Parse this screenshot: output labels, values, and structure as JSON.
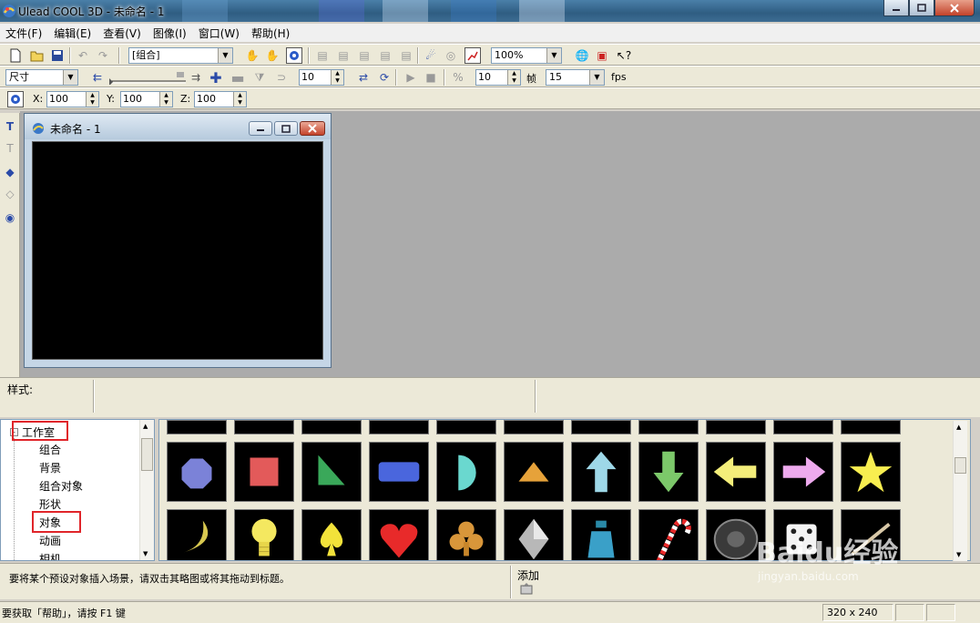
{
  "window": {
    "title": "Ulead COOL 3D - 未命名 - 1"
  },
  "menu": [
    "文件(F)",
    "编辑(E)",
    "查看(V)",
    "图像(I)",
    "窗口(W)",
    "帮助(H)"
  ],
  "toolbar1": {
    "group_select": "[组合]",
    "zoom": "100%"
  },
  "toolbar2": {
    "attribute_select": "尺寸",
    "frame_value": "10",
    "frames_value": "10",
    "frame_label": "帧",
    "fps_value": "15",
    "fps_label": "fps"
  },
  "toolbar3": {
    "x_label": "X:",
    "x_value": "100",
    "y_label": "Y:",
    "y_value": "100",
    "z_label": "Z:",
    "z_value": "100"
  },
  "document": {
    "title": "未命名 - 1"
  },
  "style_bar": {
    "label": "样式:"
  },
  "tree": {
    "root": "工作室",
    "items": [
      "组合",
      "背景",
      "组合对象",
      "形状",
      "对象",
      "动画",
      "相机"
    ],
    "highlighted": [
      "工作室",
      "对象"
    ]
  },
  "thumbnails": {
    "row1": [
      "octagon-icon",
      "square-icon",
      "triangle-icon",
      "rounded-rect-icon",
      "half-circle-icon",
      "flat-triangle-icon",
      "up-arrow-icon",
      "down-arrow-icon",
      "left-arrow-icon",
      "right-arrow-icon",
      "star-icon"
    ],
    "row2": [
      "crescent-moon-icon",
      "light-bulb-icon",
      "spade-icon",
      "heart-icon",
      "club-icon",
      "diamond-icon",
      "bottle-icon",
      "candy-cane-icon",
      "tire-icon",
      "dice-icon",
      "stick-icon"
    ],
    "colors": {
      "octagon": "#7b82d8",
      "square": "#e35a5a",
      "triangle": "#3aa85a",
      "rounded_rect": "#4a66dd",
      "half_circle": "#6ad8cf",
      "flat_triangle": "#e6a23a",
      "up_arrow": "#9ed8e8",
      "down_arrow": "#7cc86a",
      "left_arrow": "#f4ee7a",
      "right_arrow": "#eeaaee",
      "star": "#f8ee50"
    }
  },
  "hint_bar": {
    "hint": "要将某个预设对象插入场景，请双击其略图或将其拖动到标题。",
    "add_label": "添加"
  },
  "status_bar": {
    "text": "要获取「帮助」，请按 F1 键",
    "dimensions": "320 x 240"
  },
  "watermark": {
    "main": "Baidu经验",
    "sub": "jingyan.baidu.com"
  }
}
